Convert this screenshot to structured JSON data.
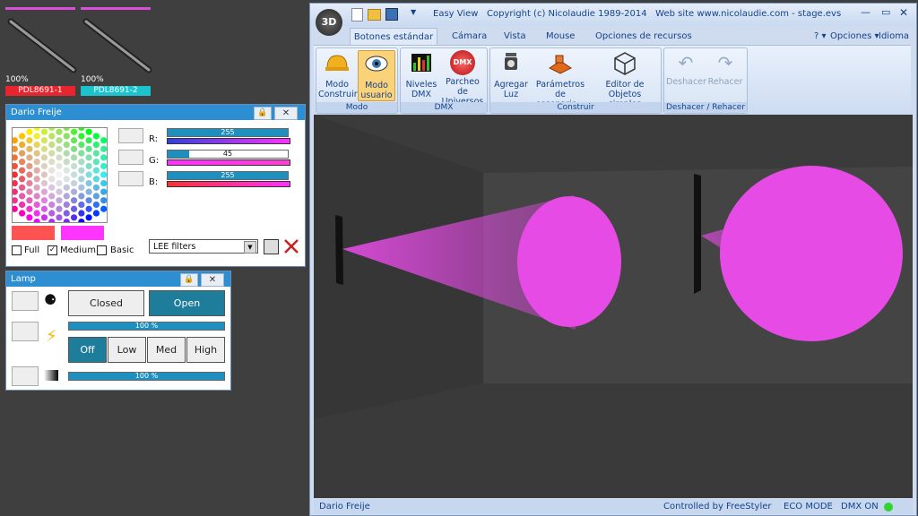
{
  "fixtures": [
    {
      "percent": "100%",
      "name": "PDL8691-1",
      "color": "#e8242f"
    },
    {
      "percent": "100%",
      "name": "PDL8691-2",
      "color": "#1bc3cc"
    }
  ],
  "color_panel": {
    "title": "Dario Freije",
    "rgb": {
      "r": {
        "label": "R:",
        "value": "255",
        "level": 1.0
      },
      "g": {
        "label": "G:",
        "value": "45",
        "level": 0.18
      },
      "b": {
        "label": "B:",
        "value": "255",
        "level": 1.0
      }
    },
    "checks": {
      "full": "Full",
      "medium": "Medium",
      "basic": "Basic",
      "checked": "Medium"
    },
    "filter_select": "LEE filters",
    "swatch_left": "#ff5353",
    "swatch_right": "#ff35ff"
  },
  "lamp_panel": {
    "title": "Lamp",
    "closed_label": "Closed",
    "open_label": "Open",
    "bar1": "100 %",
    "power": [
      "Off",
      "Low",
      "Med",
      "High"
    ],
    "bar2": "100 %"
  },
  "window": {
    "title": "Easy View   Copyright (c) Nicolaudie 1989-2014   Web site www.nicolaudie.com - stage.evs",
    "logo": "3D",
    "tabs": [
      "Botones estándar",
      "Cámara",
      "Vista",
      "Mouse",
      "Opciones de recursos"
    ],
    "right_menu": {
      "help": "?",
      "options": "Opciones",
      "language": "Idioma"
    },
    "groups": {
      "modo": "Modo",
      "dmx": "DMX",
      "construir": "Construir",
      "undo": "Deshacer / Rehacer"
    },
    "buttons": {
      "modo_construir": [
        "Modo",
        "Construir"
      ],
      "modo_usuario": [
        "Modo",
        "usuario"
      ],
      "niveles_dmx": [
        "Niveles",
        "DMX"
      ],
      "parcheo": [
        "Parcheo de",
        "Universos"
      ],
      "agregar_luz": [
        "Agregar",
        "Luz"
      ],
      "parametros": [
        "Parámetros de",
        "escenario..."
      ],
      "editor": [
        "Editor de",
        "Objetos simples"
      ],
      "deshacer": [
        "Deshacer",
        ""
      ],
      "rehacer": [
        "Rehacer",
        ""
      ]
    },
    "dmx_badge": "DMX",
    "status": {
      "left": "Dario Freije",
      "controlled": "Controlled by FreeStyler",
      "eco": "ECO MODE",
      "dmx": "DMX ON"
    },
    "colors": {
      "beam": "#e64be6",
      "accent": "#2d8fd2"
    }
  }
}
